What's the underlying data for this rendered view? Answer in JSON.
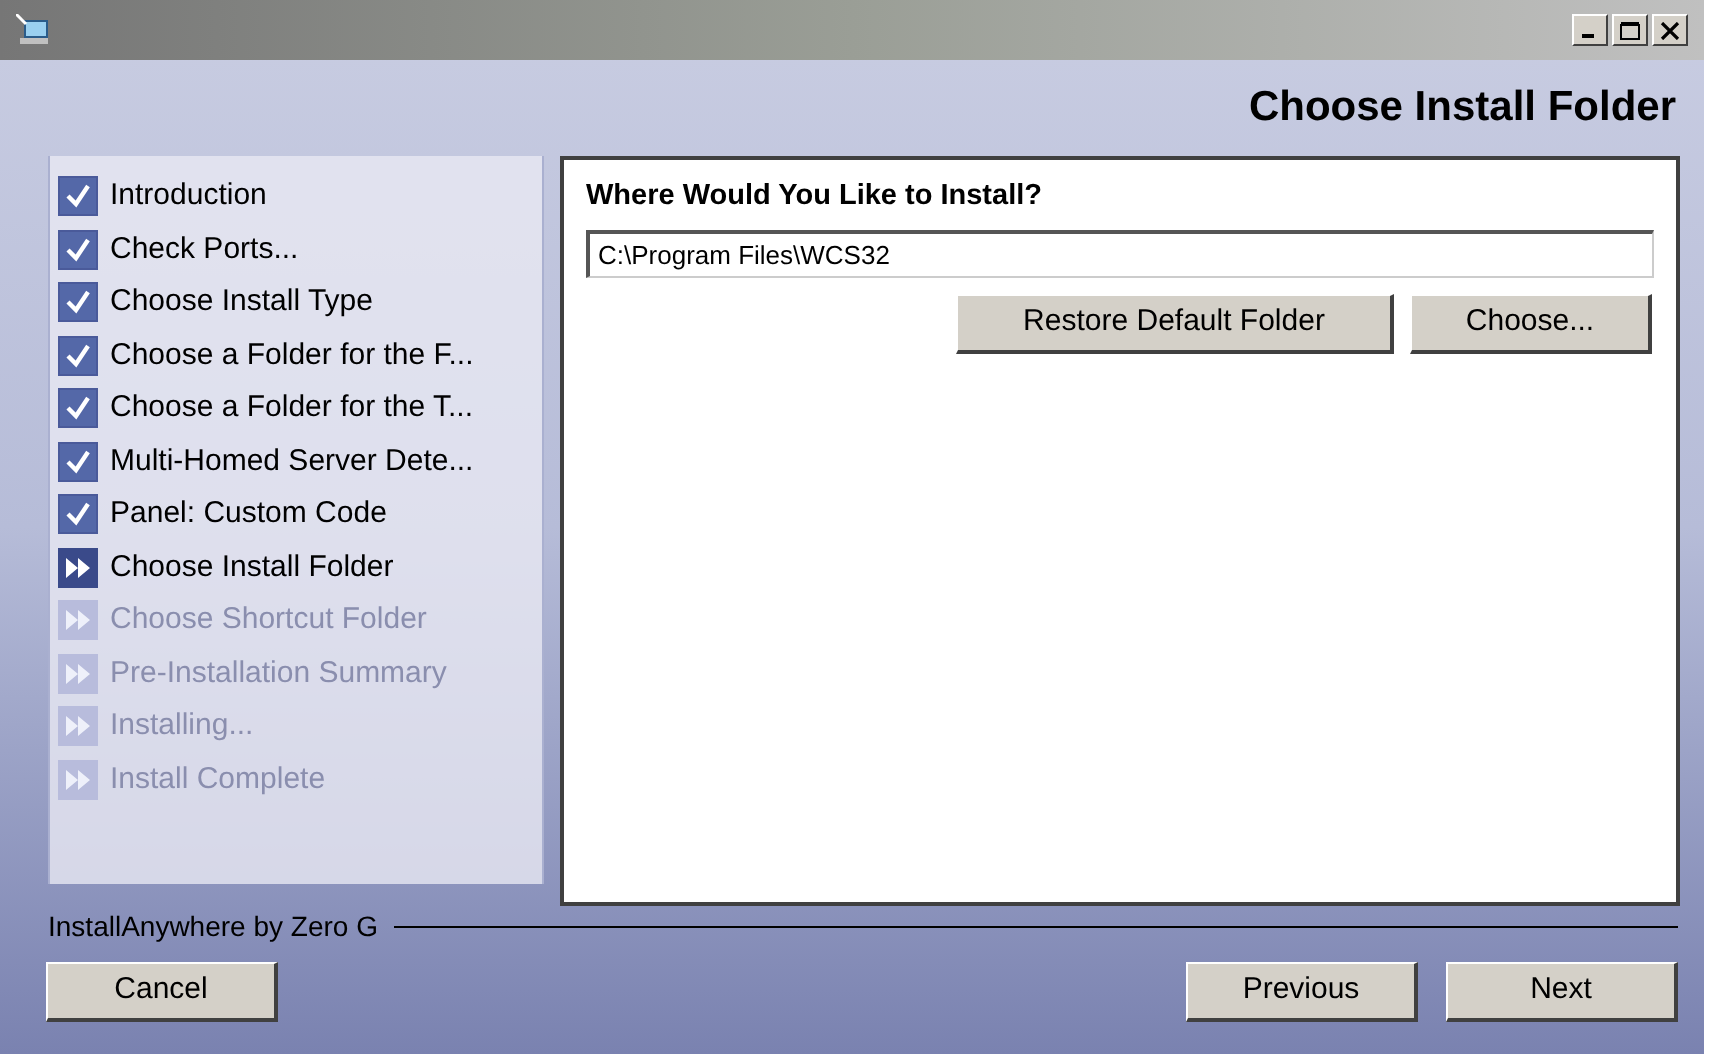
{
  "header": {
    "title": "Choose Install Folder"
  },
  "steps": [
    {
      "label": "Introduction",
      "kind": "done"
    },
    {
      "label": "Check Ports...",
      "kind": "done"
    },
    {
      "label": "Choose Install Type",
      "kind": "done"
    },
    {
      "label": "Choose a Folder for the F...",
      "kind": "done"
    },
    {
      "label": "Choose a Folder for the T...",
      "kind": "done"
    },
    {
      "label": "Multi-Homed Server Dete...",
      "kind": "done"
    },
    {
      "label": "Panel: Custom Code",
      "kind": "done"
    },
    {
      "label": "Choose Install Folder",
      "kind": "current"
    },
    {
      "label": "Choose Shortcut Folder",
      "kind": "pending"
    },
    {
      "label": "Pre-Installation Summary",
      "kind": "pending"
    },
    {
      "label": "Installing...",
      "kind": "pending"
    },
    {
      "label": "Install Complete",
      "kind": "pending"
    }
  ],
  "panel": {
    "heading": "Where Would You Like to Install?",
    "folder": "C:\\Program Files\\WCS32",
    "buttons": [
      "Restore Default Folder",
      "Choose..."
    ]
  },
  "footer": {
    "brand": "InstallAnywhere by Zero G",
    "left_button": "Cancel",
    "right_buttons": [
      "Previous",
      "Next"
    ]
  }
}
